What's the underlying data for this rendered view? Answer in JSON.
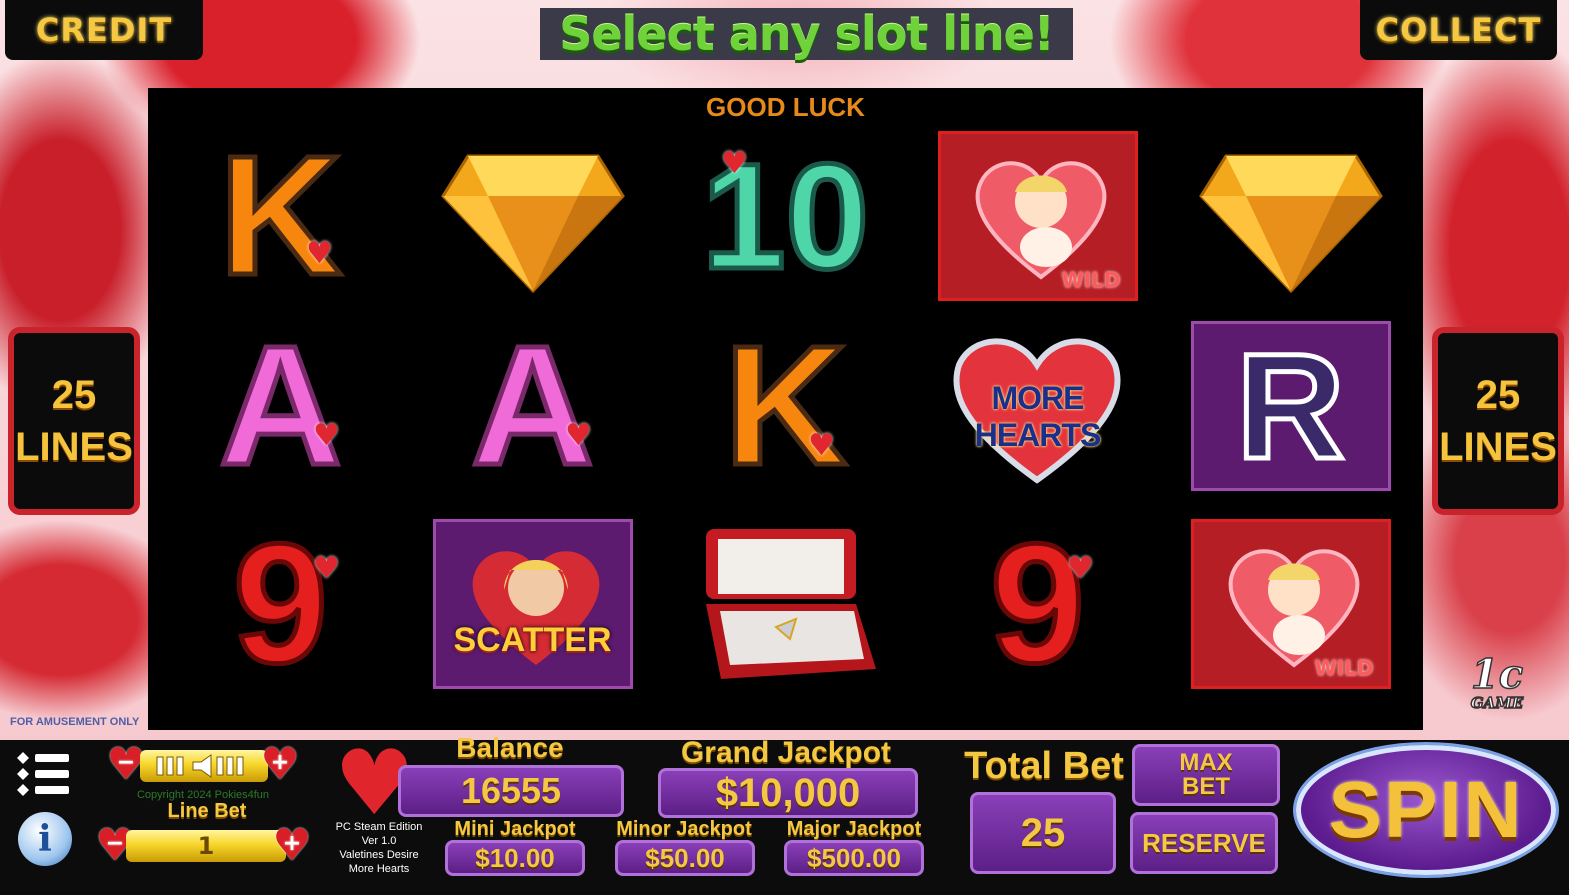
{
  "top": {
    "credit_label": "CREDIT",
    "collect_label": "COLLECT",
    "headline": "Select any slot line!"
  },
  "reels": {
    "good_luck": "GOOD LUCK",
    "grid": [
      [
        "K",
        "gem",
        "10",
        "cupid-wild",
        "gem"
      ],
      [
        "A",
        "A",
        "K",
        "more-hearts",
        "R"
      ],
      [
        "9",
        "scatter",
        "ring-box",
        "9",
        "cupid-wild"
      ]
    ],
    "wild_label": "WILD",
    "scatter_label": "SCATTER",
    "more_hearts_label": "MORE HEARTS"
  },
  "lines": {
    "count": "25",
    "label": "LINES"
  },
  "footer_note": "FOR AMUSEMENT ONLY",
  "logo": {
    "main": "1c",
    "sub": "GAME"
  },
  "bottom": {
    "copyright": "Copyright 2024 Pokies4fun",
    "line_bet_label": "Line Bet",
    "line_bet_value": "1",
    "edition_lines": [
      "PC Steam Edition",
      "Ver 1.0",
      "Valetines Desire",
      "More Hearts"
    ],
    "balance_label": "Balance",
    "balance_value": "16555",
    "grand_jackpot_label": "Grand Jackpot",
    "grand_jackpot_value": "$10,000",
    "mini_jackpot_label": "Mini Jackpot",
    "mini_jackpot_value": "$10.00",
    "minor_jackpot_label": "Minor Jackpot",
    "minor_jackpot_value": "$50.00",
    "major_jackpot_label": "Major Jackpot",
    "major_jackpot_value": "$500.00",
    "total_bet_label": "Total Bet",
    "total_bet_value": "25",
    "max_bet_label_1": "MAX",
    "max_bet_label_2": "BET",
    "reserve_label": "RESERVE",
    "spin_label": "SPIN",
    "minus": "−",
    "plus": "+"
  },
  "colors": {
    "gold": "#f4c842",
    "purple": "#5c1f86",
    "reel_bg": "#000000",
    "heart_red": "#e1252d",
    "headline_green": "#6fd23a"
  }
}
